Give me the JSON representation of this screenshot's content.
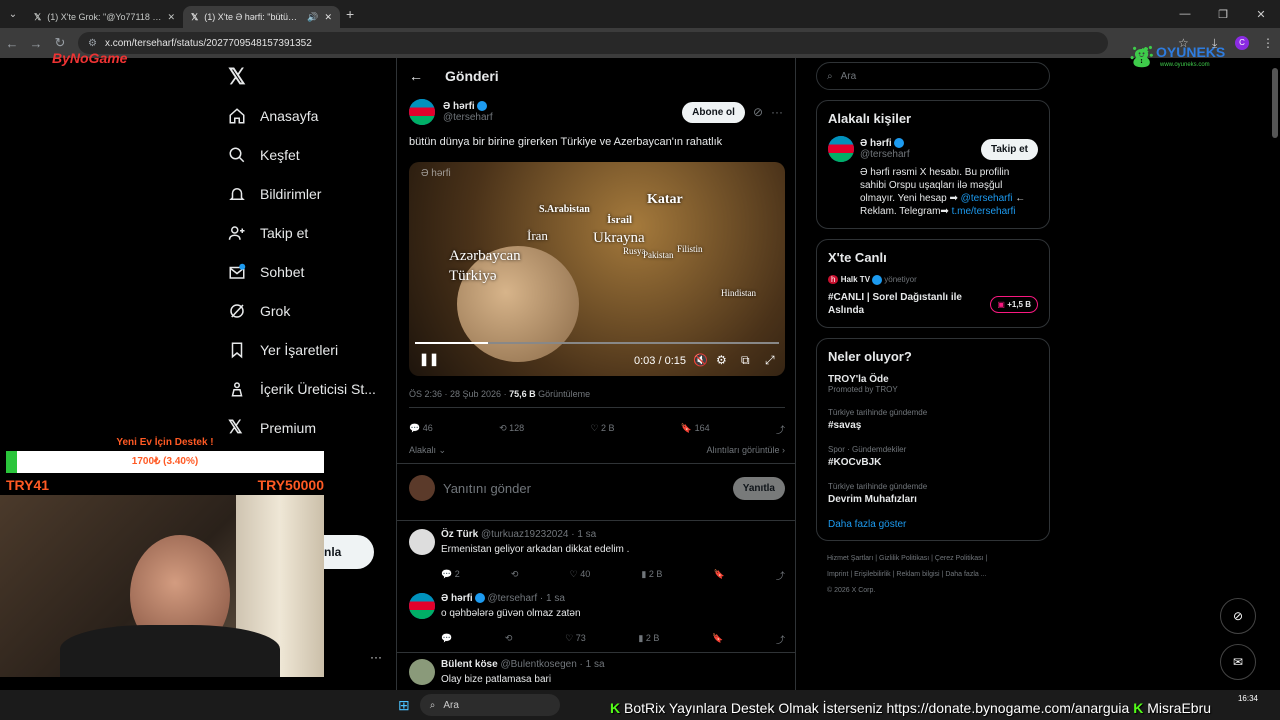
{
  "browser": {
    "tabs": [
      {
        "title": "(1) X'te Grok: \"@Yo77118 @ira...",
        "active": false
      },
      {
        "title": "(1) X'te Ə hərfi: \"bütün dün...",
        "active": true
      }
    ],
    "url": "x.com/terseharf/status/2027709548157391352"
  },
  "overlay": {
    "brand": "ByNoGame",
    "oyuneks": "OYUNEKS",
    "oyuneks_sub": "www.oyuneks.com",
    "donation_title": "Yeni Ev İçin Destek !",
    "donation_progress_text": "1700₺ (3.40%)",
    "donation_progress": 0.034,
    "min": "TRY41",
    "max": "TRY50000",
    "partial_btn": "nla"
  },
  "nav": [
    {
      "label": "Anasayfa",
      "icon": "home-icon"
    },
    {
      "label": "Keşfet",
      "icon": "search-icon"
    },
    {
      "label": "Bildirimler",
      "icon": "bell-icon"
    },
    {
      "label": "Takip et",
      "icon": "follow-icon"
    },
    {
      "label": "Sohbet",
      "icon": "mail-icon"
    },
    {
      "label": "Grok",
      "icon": "grok-icon"
    },
    {
      "label": "Yer İşaretleri",
      "icon": "bookmark-icon"
    },
    {
      "label": "İçerik Üreticisi St...",
      "icon": "creator-icon"
    },
    {
      "label": "Premium",
      "icon": "x-icon"
    }
  ],
  "main": {
    "header": "Gönderi",
    "author": {
      "name": "Ə hərfi",
      "handle": "@terseharf"
    },
    "subscribe": "Abone ol",
    "text": "bütün dünya bir birine girerken Türkiye ve Azerbaycan'ın rahatlık",
    "video": {
      "watermark": "Ə hərfi",
      "time": "0:03 / 0:15",
      "progress": 0.2,
      "labels": [
        "Katar",
        "S.Arabistan",
        "İsrail",
        "İran",
        "Ukrayna",
        "Filistin",
        "Rusya",
        "Pakistan",
        "Azərbaycan",
        "Türkiyə",
        "Hindistan"
      ]
    },
    "meta_time": "ÖS 2:36 · 28 Şub 2026 · ",
    "meta_views": "75,6 B",
    "meta_views_label": " Görüntüleme",
    "stats": {
      "replies": "46",
      "reposts": "128",
      "likes": "2 B",
      "bookmarks": "164"
    },
    "relevant": "Alakalı",
    "quotes": "Alıntıları görüntüle",
    "reply_placeholder": "Yanıtını gönder",
    "reply_button": "Yanıtla",
    "replies": [
      {
        "name": "Öz Türk",
        "handle": "@turkuaz19232024 · 1 sa",
        "text": "Ermenistan geliyor arkadan dikkat edelim .",
        "r": "2",
        "rt": "",
        "l": "40",
        "v": "2 B"
      },
      {
        "name": "Ə hərfi",
        "handle": "@terseharf · 1 sa",
        "text": "o qəhbələrə güvən olmaz zatən",
        "r": "",
        "rt": "",
        "l": "73",
        "v": "2 B"
      },
      {
        "name": "Bülent köse",
        "handle": "@Bulentkosegen · 1 sa",
        "text": "Olay bize patlamasa bari",
        "r": "",
        "rt": "",
        "l": "",
        "v": ""
      }
    ]
  },
  "right": {
    "search": "Ara",
    "related": {
      "title": "Alakalı kişiler",
      "name": "Ə hərfi",
      "handle": "@terseharf",
      "follow": "Takip et",
      "bio1": "Ə hərfi rəsmi X hesabı. Bu profilin sahibi Orspu uşaqları ilə məşğul olmayır. Yeni hesap ➡ ",
      "bio_link": "@terseharfi",
      "bio2": " ← Reklam. Telegram➡ ",
      "bio_link2": "t.me/terseharfi"
    },
    "live": {
      "title": "X'te Canlı",
      "channel": "Halk TV",
      "role": "yönetiyor",
      "show": "#CANLI | Sorel Dağıstanlı ile Aslında",
      "viewers": "+1,5 B"
    },
    "trends": {
      "title": "Neler oluyor?",
      "items": [
        {
          "cat": "",
          "name": "TROY'la Öde",
          "sub": "Promoted by TROY"
        },
        {
          "cat": "Türkiye tarihinde gündemde",
          "name": "#savaş",
          "sub": ""
        },
        {
          "cat": "Spor · Gündemdekiler",
          "name": "#KOCvBJK",
          "sub": ""
        },
        {
          "cat": "Türkiye tarihinde gündemde",
          "name": "Devrim Muhafızları",
          "sub": ""
        }
      ],
      "more": "Daha fazla göster"
    },
    "footer": [
      "Hizmet Şartları",
      "Gizlilik Politikası",
      "Çerez Politikası",
      "Imprint",
      "Erişilebilirlik",
      "Reklam bilgisi",
      "Daha fazla ...",
      "© 2026 X Corp."
    ]
  },
  "taskbar": {
    "search": "Ara",
    "time": "16:34",
    "ticker": "BotRix Yayınlara Destek Olmak İsterseniz https://donate.bynogame.com/anarguia",
    "ticker2": "MisraEbru"
  }
}
